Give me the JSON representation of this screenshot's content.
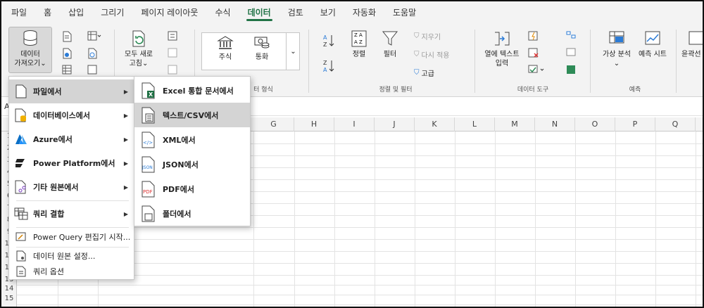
{
  "tabs": [
    "파일",
    "홈",
    "삽입",
    "그리기",
    "페이지 레이아웃",
    "수식",
    "데이터",
    "검토",
    "보기",
    "자동화",
    "도움말"
  ],
  "active_tab": "데이터",
  "ribbon": {
    "get_data": {
      "line1": "데이터",
      "line2": "가져오기⌄"
    },
    "refresh_all": {
      "line1": "모두 새로",
      "line2": "고침⌄"
    },
    "stocks": "주식",
    "currencies": "통화",
    "group_data_types_frag": "터 형식",
    "sort_asc_icon": "sort-asc-icon",
    "sort": "정렬",
    "filter": "필터",
    "clear": "지우기",
    "reapply": "다시 적용",
    "advanced": "고급",
    "group_sort_filter": "정렬 및 필터",
    "text_to_columns": {
      "line1": "열에 텍스트",
      "line2": "입력"
    },
    "group_data_tools": "데이터 도구",
    "what_if": {
      "line1": "가상 분석",
      "line2": "⌄"
    },
    "forecast_sheet": "예측 시트",
    "group_forecast": "예측",
    "outline_frag": "윤곽선"
  },
  "formula_bar": {
    "namebox_fragment": "A"
  },
  "columns": [
    "G",
    "H",
    "I",
    "J",
    "K",
    "L",
    "M",
    "N",
    "O",
    "P",
    "Q"
  ],
  "rows": [
    "1",
    "2",
    "3",
    "4",
    "5",
    "6",
    "7",
    "8",
    "9",
    "10",
    "11",
    "12",
    "13",
    "14",
    "15"
  ],
  "get_data_menu": [
    {
      "label": "파일에서",
      "icon": "file-icon",
      "submenu": true,
      "selected": true
    },
    {
      "label": "데이터베이스에서",
      "icon": "database-icon",
      "submenu": true
    },
    {
      "label": "Azure에서",
      "icon": "azure-icon",
      "submenu": true
    },
    {
      "label": "Power Platform에서",
      "icon": "power-platform-icon",
      "submenu": true
    },
    {
      "label": "기타 원본에서",
      "icon": "other-sources-icon",
      "submenu": true
    },
    {
      "label": "쿼리 결합",
      "icon": "combine-queries-icon",
      "submenu": true
    },
    {
      "label": "Power Query 편집기 시작...",
      "icon": "power-query-editor-icon",
      "submenu": false
    },
    {
      "label": "데이터 원본 설정...",
      "icon": "data-source-settings-icon",
      "submenu": false
    },
    {
      "label": "쿼리 옵션",
      "icon": "query-options-icon",
      "submenu": false
    }
  ],
  "from_file_menu": [
    {
      "label": "Excel 통합 문서에서",
      "icon": "excel-workbook-icon"
    },
    {
      "label": "텍스트/CSV에서",
      "icon": "text-csv-icon",
      "selected": true
    },
    {
      "label": "XML에서",
      "icon": "xml-icon"
    },
    {
      "label": "JSON에서",
      "icon": "json-icon"
    },
    {
      "label": "PDF에서",
      "icon": "pdf-icon"
    },
    {
      "label": "폴더에서",
      "icon": "folder-icon"
    }
  ],
  "colors": {
    "accent": "#217346",
    "selected_item": "#d4d4d4",
    "ribbon_bg": "#f3f3f3"
  }
}
